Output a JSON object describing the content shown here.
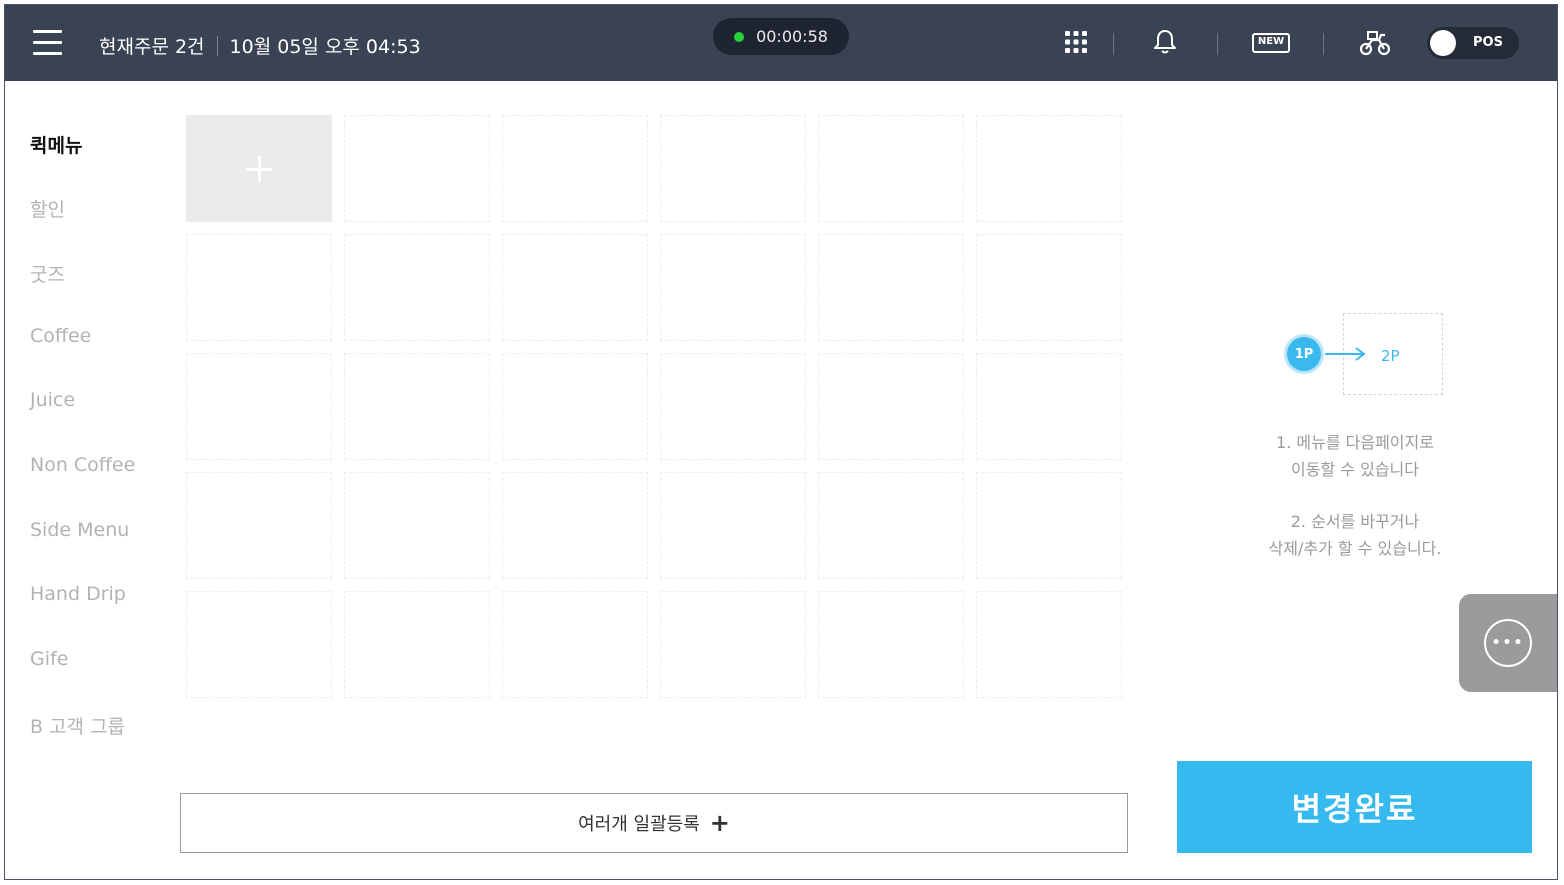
{
  "header": {
    "order_status": "현재주문 2건",
    "datetime": "10월 05일 오후 04:53",
    "timer": "00:00:58",
    "timer_status_color": "#28d23a",
    "icons": [
      "apps-grid-icon",
      "bell-icon",
      "new-badge-icon",
      "delivery-motorbike-icon"
    ],
    "new_badge": "NEW",
    "pos_toggle_label": "POS"
  },
  "categories": [
    {
      "label": "퀵메뉴",
      "active": true
    },
    {
      "label": "할인"
    },
    {
      "label": "굿즈"
    },
    {
      "label": "Coffee"
    },
    {
      "label": "Juice"
    },
    {
      "label": "Non Coffee"
    },
    {
      "label": "Side Menu"
    },
    {
      "label": "Hand Drip"
    },
    {
      "label": "Gife"
    },
    {
      "label": "B 고객 그룹"
    }
  ],
  "help": {
    "page_from": "1P",
    "page_to": "2P",
    "tip1_line1": "1. 메뉴를 다음페이지로",
    "tip1_line2": "이동할 수 있습니다",
    "tip2_line1": "2. 순서를 바꾸거나",
    "tip2_line2": "삭제/추가 할 수 있습니다."
  },
  "buttons": {
    "bulk_register": "여러개 일괄등록",
    "bulk_register_icon": "+",
    "done": "변경완료"
  },
  "colors": {
    "topbar": "#3a4354",
    "accent": "#36b9ef"
  }
}
